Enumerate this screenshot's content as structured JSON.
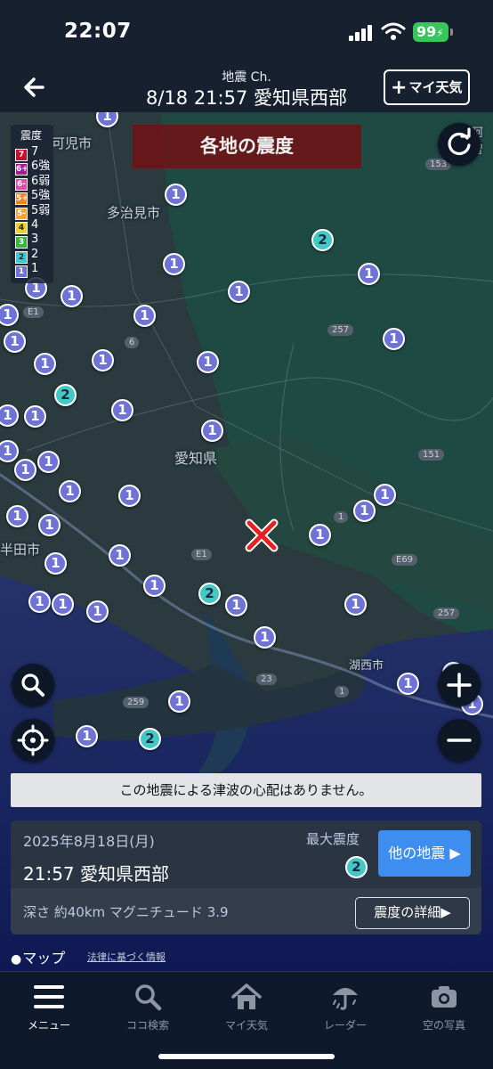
{
  "status": {
    "time": "22:07",
    "battery": "99"
  },
  "nav": {
    "subtitle": "地震 Ch.",
    "title": "8/18 21:57 愛知県西部",
    "my_weather_plus": "+",
    "my_weather_label": "マイ天気"
  },
  "map": {
    "title": "各地の震度",
    "legend": {
      "heading": "震度",
      "items": [
        {
          "badge": "7",
          "label": "7",
          "color": "#c8102e"
        },
        {
          "badge": "6+",
          "label": "6強",
          "color": "#a6199b"
        },
        {
          "badge": "6-",
          "label": "6弱",
          "color": "#e24ca9"
        },
        {
          "badge": "5+",
          "label": "5強",
          "color": "#f0831e"
        },
        {
          "badge": "5-",
          "label": "5弱",
          "color": "#f2a33a"
        },
        {
          "badge": "4",
          "label": "4",
          "color": "#e9d429"
        },
        {
          "badge": "3",
          "label": "3",
          "color": "#39b53f"
        },
        {
          "badge": "2",
          "label": "2",
          "color": "#43c9c5"
        },
        {
          "badge": "1",
          "label": "1",
          "color": "#6f73d6"
        }
      ]
    },
    "place_labels": {
      "kani": "可児市",
      "tajimi": "多治見市",
      "aichi": "愛知県",
      "handa": "半田市",
      "kosai": "湖西市",
      "aga": "阿智"
    },
    "road_labels": {
      "e1": "E1",
      "r257": "257",
      "r6": "6",
      "r153": "153",
      "r151": "151",
      "r1": "1",
      "e69": "E69",
      "r257b": "257",
      "r23": "23",
      "r259": "259",
      "e1b": "E1"
    },
    "intensity_1": "1",
    "intensity_2": "2"
  },
  "tsunami_notice": "この地震による津波の心配はありません。",
  "quake": {
    "date": "2025年8月18日(月)",
    "time_place": "21:57 愛知県西部",
    "max_label": "最大震度",
    "max_value": "2",
    "other_button": "他の地震 ▶",
    "depth_magnitude": "深さ 約40km マグニチュード 3.9",
    "detail_button": "震度の詳細▶"
  },
  "attribution": {
    "apple_maps": "マップ",
    "legal": "法律に基づく情報"
  },
  "tabs": [
    {
      "label": "メニュー",
      "icon": "menu-icon"
    },
    {
      "label": "ココ検索",
      "icon": "search-icon"
    },
    {
      "label": "マイ天気",
      "icon": "home-icon"
    },
    {
      "label": "レーダー",
      "icon": "umbrella-icon"
    },
    {
      "label": "空の写真",
      "icon": "camera-icon"
    }
  ]
}
